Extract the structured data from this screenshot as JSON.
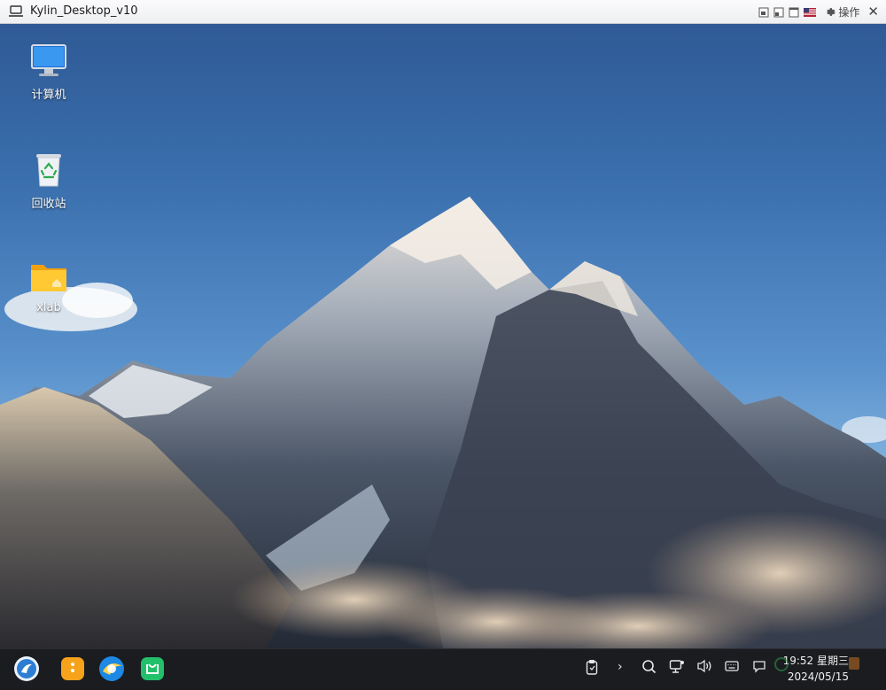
{
  "window": {
    "title": "Kylin_Desktop_v10",
    "operations_label": "操作",
    "controls": [
      "restore-icon",
      "minimize-icon",
      "maximize-icon",
      "flag-icon",
      "gear-icon",
      "close-icon"
    ]
  },
  "desktop": {
    "icons": [
      {
        "label": "计算机",
        "icon": "computer-icon"
      },
      {
        "label": "回收站",
        "icon": "trash-icon"
      },
      {
        "label": "xlab",
        "icon": "folder-icon"
      }
    ]
  },
  "taskbar": {
    "apps": [
      "start-menu-icon",
      "file-manager-icon",
      "browser-icon",
      "app-store-icon"
    ],
    "tray": [
      "clipboard-icon",
      "expand-tray-icon",
      "search-icon",
      "network-icon",
      "volume-icon",
      "keyboard-icon",
      "notification-icon"
    ],
    "clock": {
      "time": "19:52 星期三",
      "date": "2024/05/15"
    }
  },
  "colors": {
    "sky_top": "#2f5a95",
    "taskbar": "#1a1c20",
    "title_bar": "#f2f3f5"
  }
}
